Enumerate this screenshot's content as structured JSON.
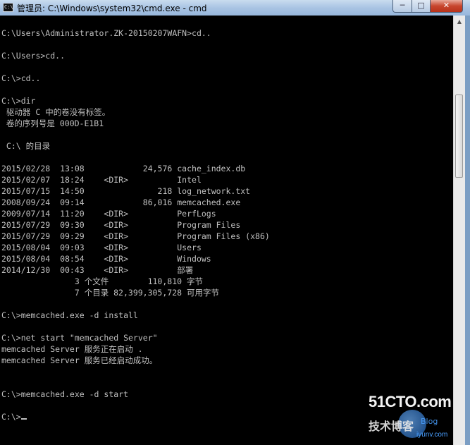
{
  "window": {
    "title": "管理员: C:\\Windows\\system32\\cmd.exe - cmd",
    "icon": "cmd-icon",
    "icon_glyph": "C:\\",
    "minimize_glyph": "─",
    "maximize_glyph": "□",
    "close_glyph": "✕"
  },
  "console": {
    "lines": [
      "C:\\Users\\Administrator.ZK-20150207WAFN>cd..",
      "",
      "C:\\Users>cd..",
      "",
      "C:\\>cd..",
      "",
      "C:\\>dir",
      " 驱动器 C 中的卷没有标签。",
      " 卷的序列号是 000D-E1B1",
      "",
      " C:\\ 的目录",
      "",
      "2015/02/28  13:08            24,576 cache_index.db",
      "2015/02/07  18:24    <DIR>          Intel",
      "2015/07/15  14:50               218 log_network.txt",
      "2008/09/24  09:14            86,016 memcached.exe",
      "2009/07/14  11:20    <DIR>          PerfLogs",
      "2015/07/29  09:30    <DIR>          Program Files",
      "2015/07/29  09:29    <DIR>          Program Files (x86)",
      "2015/08/04  09:03    <DIR>          Users",
      "2015/08/04  08:54    <DIR>          Windows",
      "2014/12/30  00:43    <DIR>          部署",
      "               3 个文件        110,810 字节",
      "               7 个目录 82,399,305,728 可用字节",
      "",
      "C:\\>memcached.exe -d install",
      "",
      "C:\\>net start \"memcached Server\"",
      "memcached Server 服务正在启动 .",
      "memcached Server 服务已经启动成功。",
      "",
      "",
      "C:\\>memcached.exe -d start",
      "",
      "C:\\>"
    ],
    "text_color": "#c0c0c0",
    "background": "#000000"
  },
  "watermark": {
    "main": "51CTO.com",
    "sub": "技术博客",
    "blog": "Blog",
    "url": "iyunv.com"
  }
}
